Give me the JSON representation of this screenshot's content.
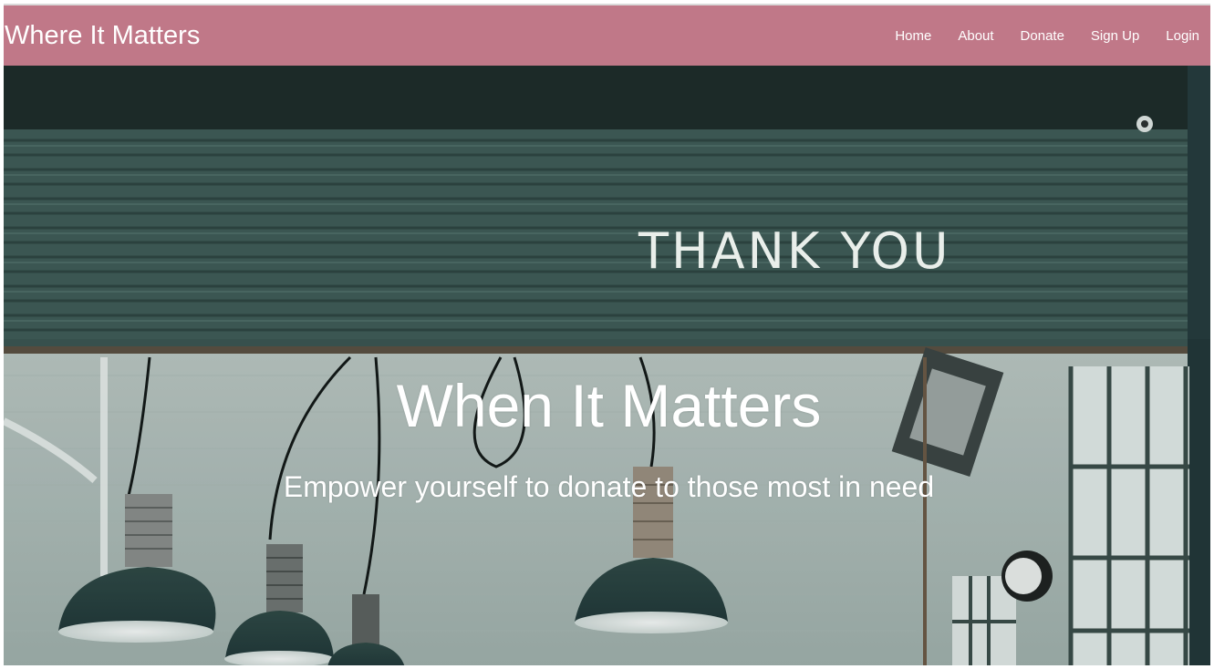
{
  "navbar": {
    "brand": "Where It Matters",
    "links": [
      "Home",
      "About",
      "Donate",
      "Sign Up",
      "Login"
    ],
    "background_color": "#c07888"
  },
  "hero": {
    "title": "When It Matters",
    "subtitle": "Empower yourself to donate to those most in need",
    "image": {
      "description_icon": "storefront-shutter-image",
      "shutter_text": "THANK YOU"
    }
  }
}
